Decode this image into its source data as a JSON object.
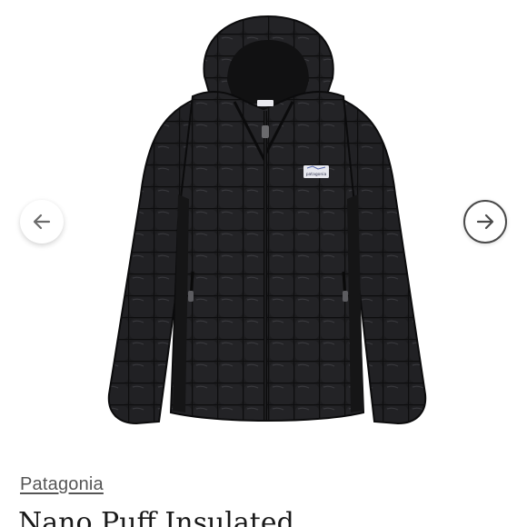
{
  "listing": {
    "brand": "Patagonia",
    "title": "Nano Puff Insulated",
    "image": {
      "subject": "black quilted hooded puffer jacket",
      "logo_text": "patagonia"
    }
  },
  "gallery": {
    "prev_icon": "arrow-left-icon",
    "next_icon": "arrow-right-icon"
  }
}
